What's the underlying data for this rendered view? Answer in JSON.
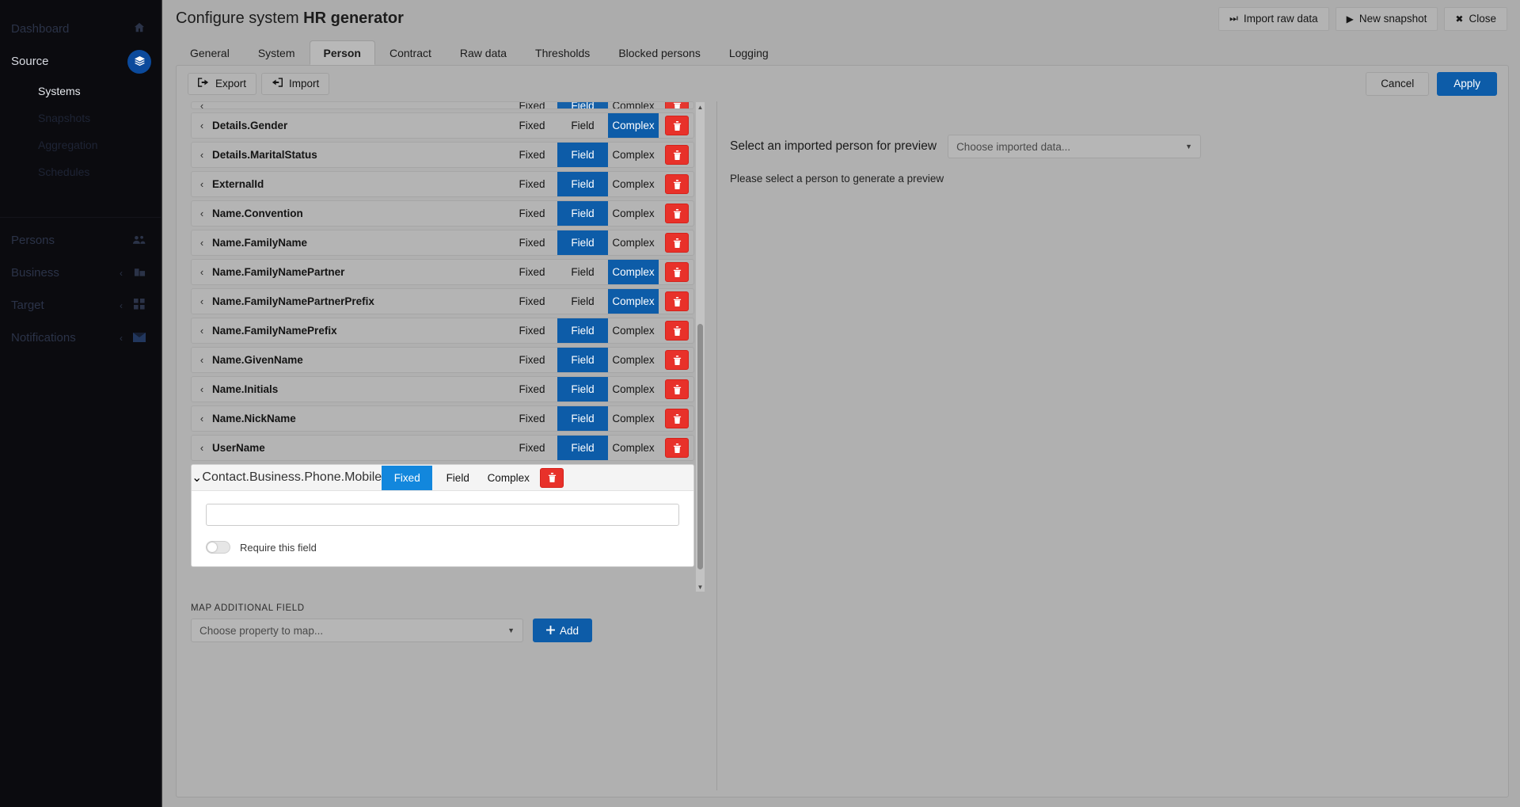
{
  "sidebar": {
    "items": [
      {
        "label": "Dashboard",
        "icon": "home-icon",
        "chevron": "",
        "badge": false
      },
      {
        "label": "Source",
        "icon": "layers-icon",
        "chevron": "⌄",
        "badge": true
      }
    ],
    "source_children": [
      {
        "label": "Systems",
        "current": true
      },
      {
        "label": "Snapshots",
        "current": false
      },
      {
        "label": "Aggregation",
        "current": false
      },
      {
        "label": "Schedules",
        "current": false
      }
    ],
    "lower_items": [
      {
        "label": "Persons",
        "icon": "people-icon",
        "chevron": ""
      },
      {
        "label": "Business",
        "icon": "building-icon",
        "chevron": "‹"
      },
      {
        "label": "Target",
        "icon": "grid-icon",
        "chevron": "‹"
      },
      {
        "label": "Notifications",
        "icon": "mail-icon",
        "chevron": "‹"
      }
    ]
  },
  "header": {
    "title_prefix": "Configure system ",
    "title_bold": "HR generator",
    "buttons": [
      {
        "label": "Import raw data",
        "icon": "skip-forward-icon",
        "glyph": "⏭"
      },
      {
        "label": "New snapshot",
        "icon": "play-icon",
        "glyph": "▶"
      },
      {
        "label": "Close",
        "icon": "close-icon",
        "glyph": "✖"
      }
    ]
  },
  "tabs": [
    {
      "label": "General",
      "active": false
    },
    {
      "label": "System",
      "active": false
    },
    {
      "label": "Person",
      "active": true
    },
    {
      "label": "Contract",
      "active": false
    },
    {
      "label": "Raw data",
      "active": false
    },
    {
      "label": "Thresholds",
      "active": false
    },
    {
      "label": "Blocked persons",
      "active": false
    },
    {
      "label": "Logging",
      "active": false
    }
  ],
  "toolbar": {
    "export_label": "Export",
    "export_glyph": "⮕",
    "import_label": "Import",
    "import_glyph": "⬅",
    "cancel_label": "Cancel",
    "apply_label": "Apply"
  },
  "segment_labels": {
    "fixed": "Fixed",
    "field": "Field",
    "complex": "Complex"
  },
  "delete_glyph": "🗑",
  "rows": [
    {
      "name": "Details.Gender",
      "collapsed": true,
      "selected": "complex"
    },
    {
      "name": "Details.MaritalStatus",
      "collapsed": true,
      "selected": "field"
    },
    {
      "name": "ExternalId",
      "collapsed": true,
      "selected": "field"
    },
    {
      "name": "Name.Convention",
      "collapsed": true,
      "selected": "field"
    },
    {
      "name": "Name.FamilyName",
      "collapsed": true,
      "selected": "field"
    },
    {
      "name": "Name.FamilyNamePartner",
      "collapsed": true,
      "selected": "complex"
    },
    {
      "name": "Name.FamilyNamePartnerPrefix",
      "collapsed": true,
      "selected": "complex"
    },
    {
      "name": "Name.FamilyNamePrefix",
      "collapsed": true,
      "selected": "field"
    },
    {
      "name": "Name.GivenName",
      "collapsed": true,
      "selected": "field"
    },
    {
      "name": "Name.Initials",
      "collapsed": true,
      "selected": "field"
    },
    {
      "name": "Name.NickName",
      "collapsed": true,
      "selected": "field"
    },
    {
      "name": "UserName",
      "collapsed": true,
      "selected": "field"
    }
  ],
  "expanded_row": {
    "name": "Contact.Business.Phone.Mobile",
    "selected": "fixed",
    "input_value": "",
    "input_placeholder": "",
    "require_label": "Require this field",
    "require_on": false
  },
  "map_additional": {
    "section_label": "MAP ADDITIONAL FIELD",
    "select_value": "Choose property to map...",
    "add_label": "Add",
    "add_glyph": "➕"
  },
  "preview": {
    "title": "Select an imported person for preview",
    "select_value": "Choose imported data...",
    "hint": "Please select a person to generate a preview"
  },
  "colors": {
    "accent_blue": "#0d5ca8",
    "accent_light_blue": "#1287dd",
    "danger_red": "#e8312a",
    "panel_gray": "#b0b0b0",
    "sidebar_dark": "#0b0b0f"
  }
}
